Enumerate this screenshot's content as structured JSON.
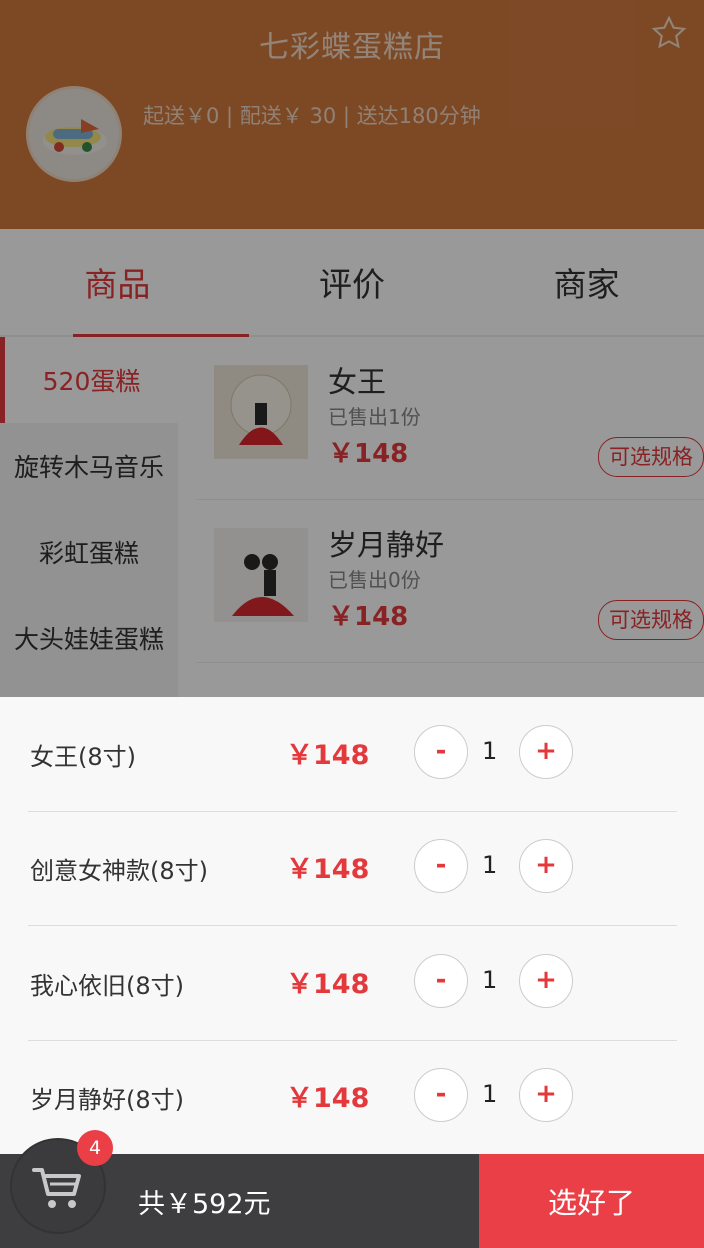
{
  "shop": {
    "title": "七彩蝶蛋糕店",
    "delivery_info": "起送￥0 | 配送￥ 30 | 送达180分钟"
  },
  "tabs": [
    {
      "label": "商品",
      "active": true
    },
    {
      "label": "评价",
      "active": false
    },
    {
      "label": "商家",
      "active": false
    }
  ],
  "sidebar": {
    "items": [
      {
        "label": "520蛋糕",
        "active": true
      },
      {
        "label": "旋转木马音乐",
        "active": false
      },
      {
        "label": "彩虹蛋糕",
        "active": false
      },
      {
        "label": "大头娃娃蛋糕",
        "active": false
      }
    ]
  },
  "products": [
    {
      "name": "女王",
      "sold": "已售出1份",
      "price": "￥148",
      "spec_label": "可选规格"
    },
    {
      "name": "岁月静好",
      "sold": "已售出0份",
      "price": "￥148",
      "spec_label": "可选规格"
    }
  ],
  "cart": {
    "items": [
      {
        "name": "女王(8寸)",
        "price": "￥148",
        "qty": "1",
        "minus": "-",
        "plus": "+"
      },
      {
        "name": "创意女神款(8寸)",
        "price": "￥148",
        "qty": "1",
        "minus": "-",
        "plus": "+"
      },
      {
        "name": "我心依旧(8寸)",
        "price": "￥148",
        "qty": "1",
        "minus": "-",
        "plus": "+"
      },
      {
        "name": "岁月静好(8寸)",
        "price": "￥148",
        "qty": "1",
        "minus": "-",
        "plus": "+"
      }
    ],
    "badge_count": "4",
    "total_label": "共￥592元",
    "confirm_label": "选好了"
  },
  "colors": {
    "header_bg": "#d07a3f",
    "accent": "#e4393c",
    "bottom_bar": "#3e3e40",
    "confirm_bg": "#ea3f47"
  },
  "icons": [
    "star-icon",
    "cart-icon"
  ]
}
